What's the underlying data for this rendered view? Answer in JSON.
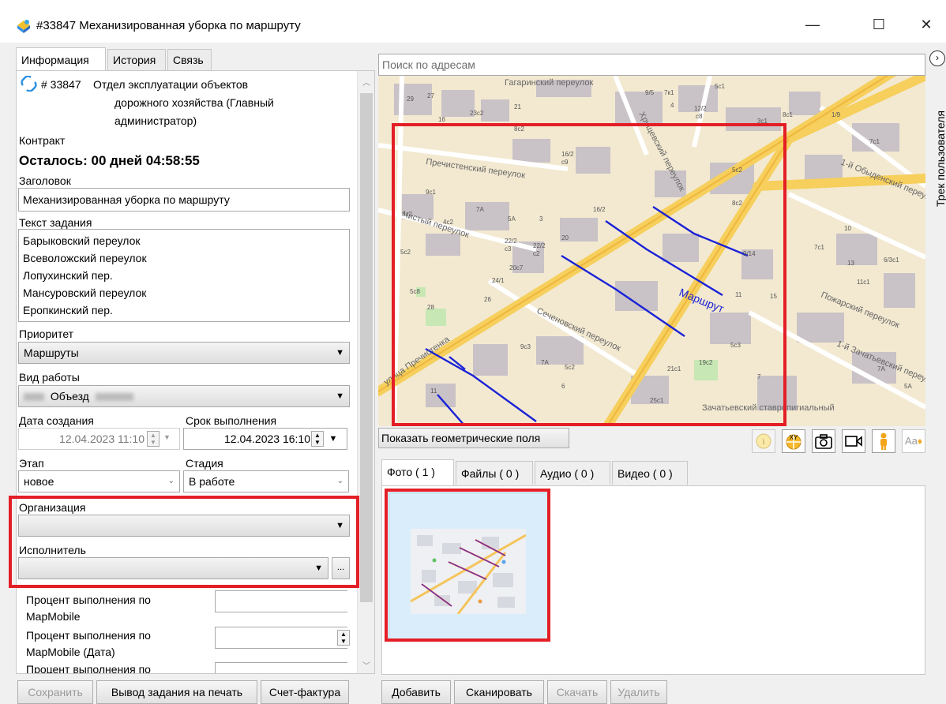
{
  "window": {
    "title": "#33847 Механизированная уборка по маршруту",
    "controls": {
      "minimize": "—",
      "maximize": "☐",
      "close": "✕"
    }
  },
  "left_tabs": [
    "Информация",
    "История",
    "Связь"
  ],
  "info": {
    "id": "# 33847",
    "org_name_lines": [
      "Отдел эксплуатации объектов",
      "дорожного хозяйства (Главный",
      "администратор)"
    ],
    "contract_label": "Контракт",
    "remaining": "Осталось: 00 дней 04:58:55",
    "title_label": "Заголовок",
    "title_value": "Механизированная уборка по маршруту",
    "task_text_label": "Текст задания",
    "task_text_lines": [
      "Барыковский переулок",
      "Всеволожский переулок",
      "Лопухинский пер.",
      "Мансуровский переулок",
      "Еропкинский пер."
    ],
    "priority_label": "Приоритет",
    "priority_value": "Маршруты",
    "work_type_label": "Вид работы",
    "work_type_value": "Объезд",
    "created_label": "Дата создания",
    "created_value": "12.04.2023 11:10",
    "deadline_label": "Срок выполнения",
    "deadline_value": "12.04.2023 16:10",
    "stage_label": "Этап",
    "stage_value": "новое",
    "status_label": "Стадия",
    "status_value": "В работе",
    "organization_label": "Организация",
    "organization_value": "",
    "executor_label": "Исполнитель",
    "executor_value": "",
    "executor_more": "...",
    "percent1_label_lines": [
      "Процент выполнения по",
      "MapMobile"
    ],
    "percent2_label_lines": [
      "Процент выполнения по",
      "MapMobile (Дата)"
    ],
    "percent3_label": "Процент выполнения по"
  },
  "left_buttons": {
    "save": "Сохранить",
    "print": "Вывод задания на печать",
    "invoice": "Счет-фактура"
  },
  "map": {
    "search_placeholder": "Поиск по адресам",
    "route_label": "Маршрут",
    "street_labels": [
      "Гагаринский переулок",
      "Хрущевский переулок",
      "Пречистенский переулок",
      "Чистый переулок",
      "Сеченовский переулок",
      "улица Пречистенка",
      "1-й Обыденский переулок",
      "Пожарский переулок",
      "1-й Зачатьевский переулок",
      "Зачатьевский ставропигиальный"
    ],
    "house_numbers": [
      "29",
      "27",
      "9/5",
      "7к1",
      "5с1",
      "21",
      "23с2",
      "16",
      "8с2",
      "3с1",
      "8с1",
      "12/2",
      "с8",
      "9с1",
      "16/2",
      "с9",
      "7А",
      "5А",
      "3",
      "8с2",
      "4с2",
      "16/2",
      "20с7",
      "5с2",
      "22/2",
      "с3",
      "22/2",
      "с2",
      "20",
      "24/1",
      "5с8",
      "28",
      "26",
      "9с3",
      "7А",
      "5с2",
      "6",
      "11",
      "21с1",
      "19с2",
      "25с1",
      "5с3",
      "11",
      "15",
      "9/14",
      "7с1",
      "10",
      "13",
      "11с1",
      "6/3с1",
      "1/9",
      "7с1",
      "7А",
      "5А",
      "7",
      "8с2",
      "5с2",
      "4"
    ],
    "side_panel_label": "Трек пользователя",
    "show_geometry_button": "Показать геометрические поля",
    "toolbar_icons": [
      "info-icon",
      "xy-coordinates-icon",
      "camera-icon",
      "video-camera-icon",
      "person-icon",
      "text-style-icon"
    ]
  },
  "media_tabs": [
    "Фото ( 1 )",
    "Файлы ( 0 )",
    "Аудио ( 0 )",
    "Видео ( 0 )"
  ],
  "media_buttons": {
    "add": "Добавить",
    "scan": "Сканировать",
    "download": "Скачать",
    "delete": "Удалить"
  },
  "colors": {
    "highlight": "#e41e26",
    "route": "#1a22d6",
    "main_road": "#f6cf5c",
    "building": "#c9c2c6",
    "thumb_selection": "#d9eefa"
  }
}
